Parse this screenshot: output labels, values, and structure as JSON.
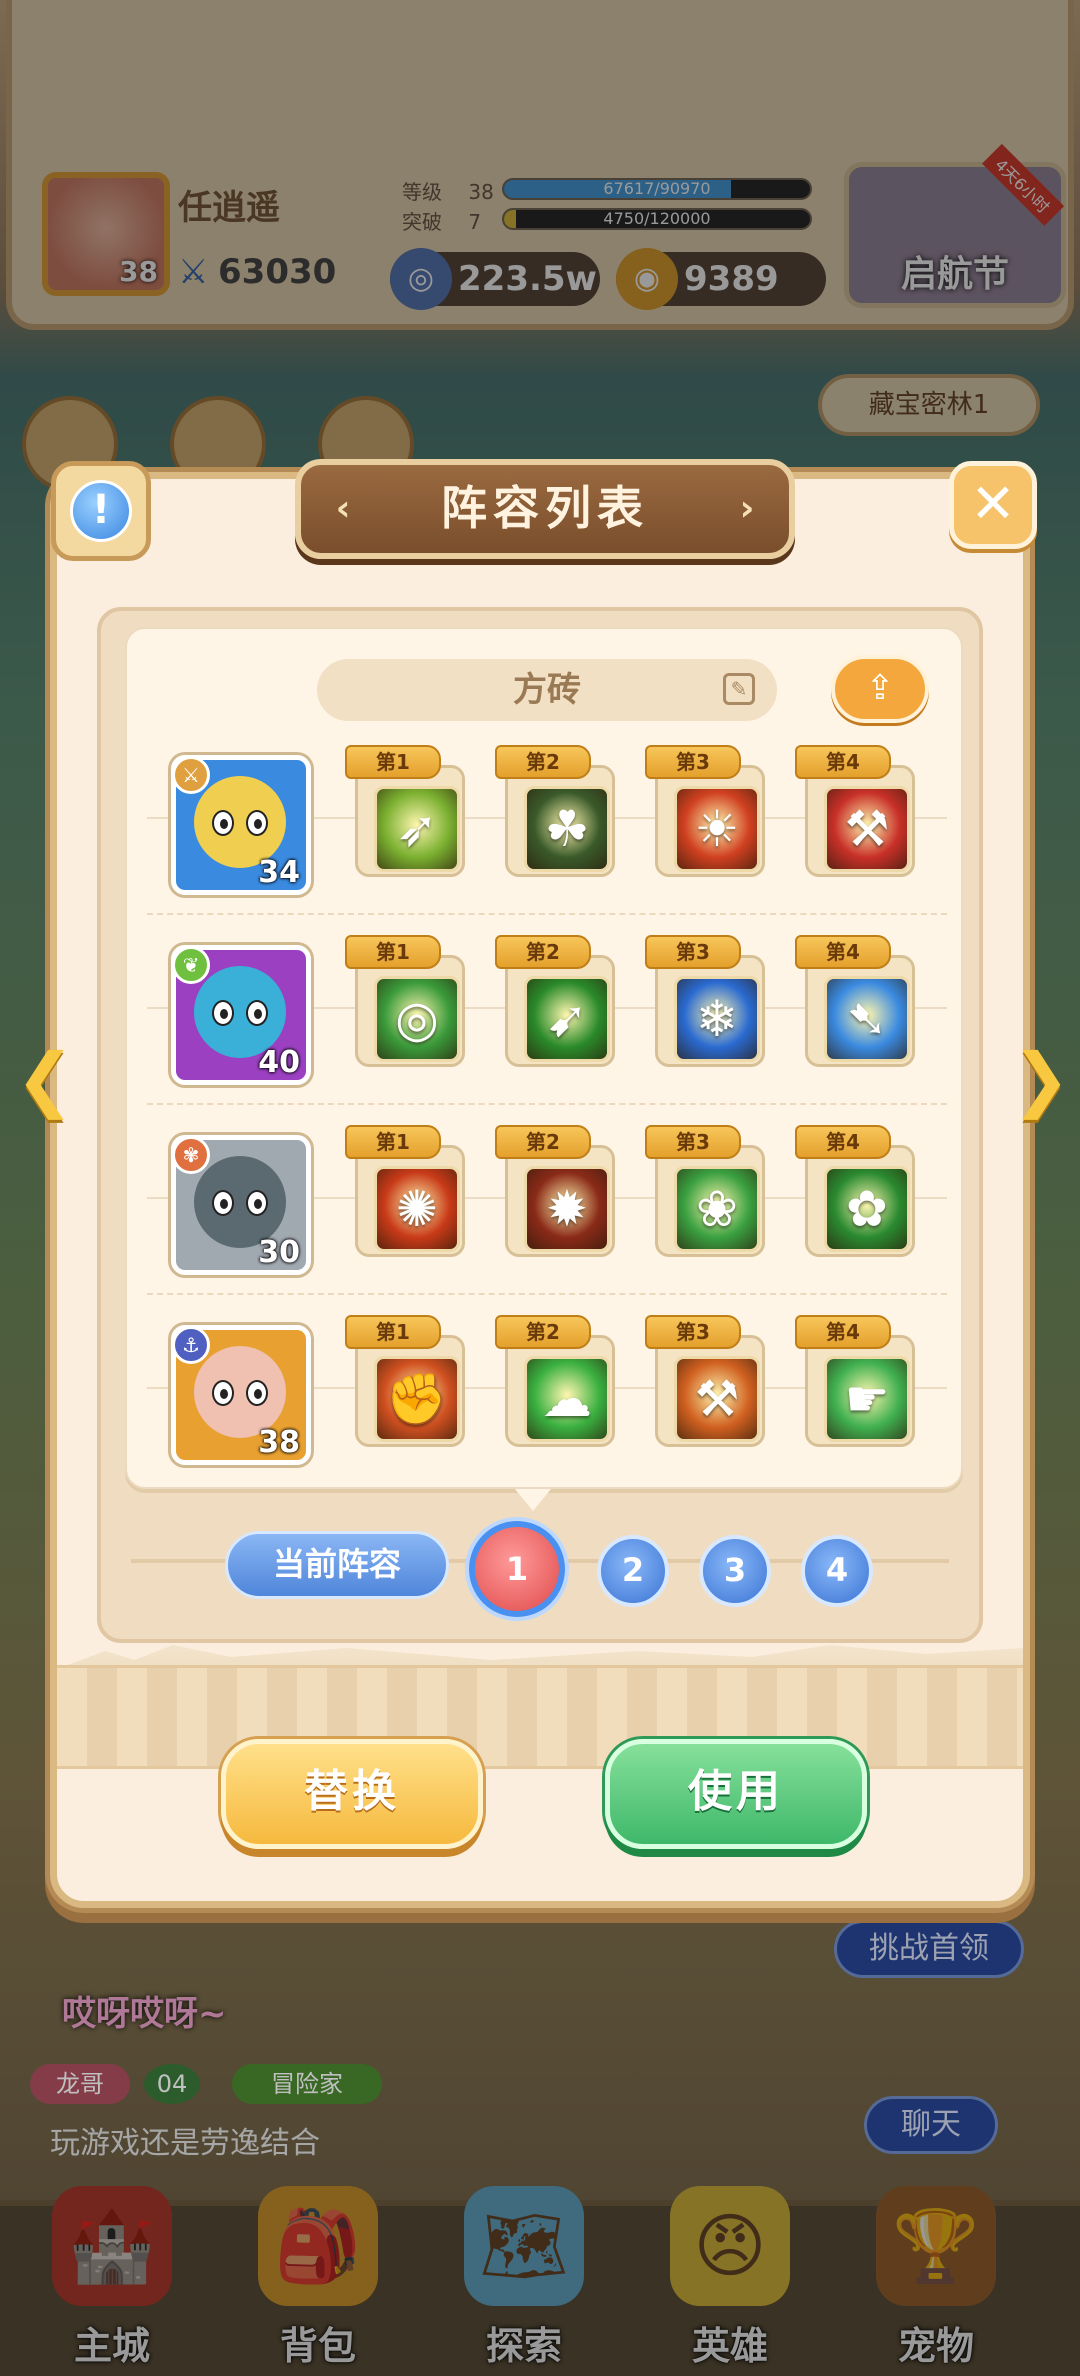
{
  "header": {
    "player_name": "任逍遥",
    "player_level": "38",
    "power": "63030",
    "level_label": "等级",
    "level_value": "38",
    "level_exp": "67617/90970",
    "level_progress": 0.743,
    "break_label": "突破",
    "break_value": "7",
    "break_exp": "4750/120000",
    "break_progress": 0.04,
    "coins": "223.5w",
    "gems": "9389",
    "event_label": "启航节",
    "event_tag": "4天6小时"
  },
  "side": {
    "area_name": "藏宝密林1",
    "challenge_boss": "挑战首领",
    "chat": "聊天"
  },
  "chat": {
    "shout": "哎呀哎呀~",
    "sender": "龙哥",
    "sender_level": "04",
    "sender_title": "冒险家",
    "message": "玩游戏还是劳逸结合"
  },
  "nav": {
    "items": [
      {
        "label": "主城",
        "icon": "castle-icon"
      },
      {
        "label": "背包",
        "icon": "bag-icon"
      },
      {
        "label": "探索",
        "icon": "map-icon"
      },
      {
        "label": "英雄",
        "icon": "hero-icon"
      },
      {
        "label": "宠物",
        "icon": "pet-icon"
      }
    ]
  },
  "modal": {
    "title": "阵容列表",
    "lineup_name": "方砖",
    "heroes": [
      {
        "level": "34",
        "badge_icon": "sword-icon",
        "badge_color": "#e0a040",
        "bg_color": "#3a8ae0",
        "face_color": "#f0cf50",
        "skills": [
          {
            "tab": "第1",
            "icon": "arrow-strike-icon",
            "color": "#7ab030"
          },
          {
            "tab": "第2",
            "icon": "dark-leaf-icon",
            "color": "#3a5a2a"
          },
          {
            "tab": "第3",
            "icon": "fire-roar-icon",
            "color": "#d04020"
          },
          {
            "tab": "第4",
            "icon": "axe-icon",
            "color": "#c83028"
          }
        ]
      },
      {
        "level": "40",
        "badge_icon": "leaf-icon",
        "badge_color": "#70c040",
        "bg_color": "#9a40c0",
        "face_color": "#3ab0d8",
        "skills": [
          {
            "tab": "第1",
            "icon": "target-icon",
            "color": "#3a9a3a"
          },
          {
            "tab": "第2",
            "icon": "green-spear-icon",
            "color": "#2a8a2a"
          },
          {
            "tab": "第3",
            "icon": "water-splash-icon",
            "color": "#2a6ad0"
          },
          {
            "tab": "第4",
            "icon": "blue-spear-icon",
            "color": "#3a8ae0"
          }
        ]
      },
      {
        "level": "30",
        "badge_icon": "paw-icon",
        "badge_color": "#e07040",
        "bg_color": "#a0a8b0",
        "face_color": "#5a6a70",
        "skills": [
          {
            "tab": "第1",
            "icon": "paw-strike-icon",
            "color": "#c83a18"
          },
          {
            "tab": "第2",
            "icon": "dark-burst-icon",
            "color": "#8a2a18"
          },
          {
            "tab": "第3",
            "icon": "green-orb-icon",
            "color": "#3aa040"
          },
          {
            "tab": "第4",
            "icon": "leaf-star-icon",
            "color": "#2a8a30"
          }
        ]
      },
      {
        "level": "38",
        "badge_icon": "anchor-icon",
        "badge_color": "#5060c0",
        "bg_color": "#e8a030",
        "face_color": "#f0c0b0",
        "skills": [
          {
            "tab": "第1",
            "icon": "fist-icon",
            "color": "#d05020"
          },
          {
            "tab": "第2",
            "icon": "green-cloud-icon",
            "color": "#3ab040"
          },
          {
            "tab": "第3",
            "icon": "hammer-icon",
            "color": "#d06020"
          },
          {
            "tab": "第4",
            "icon": "green-hand-icon",
            "color": "#40b050"
          }
        ]
      }
    ],
    "current_lineup_label": "当前阵容",
    "lineup_numbers": [
      "1",
      "2",
      "3",
      "4"
    ],
    "active_lineup": "1",
    "replace_button": "替换",
    "use_button": "使用"
  }
}
